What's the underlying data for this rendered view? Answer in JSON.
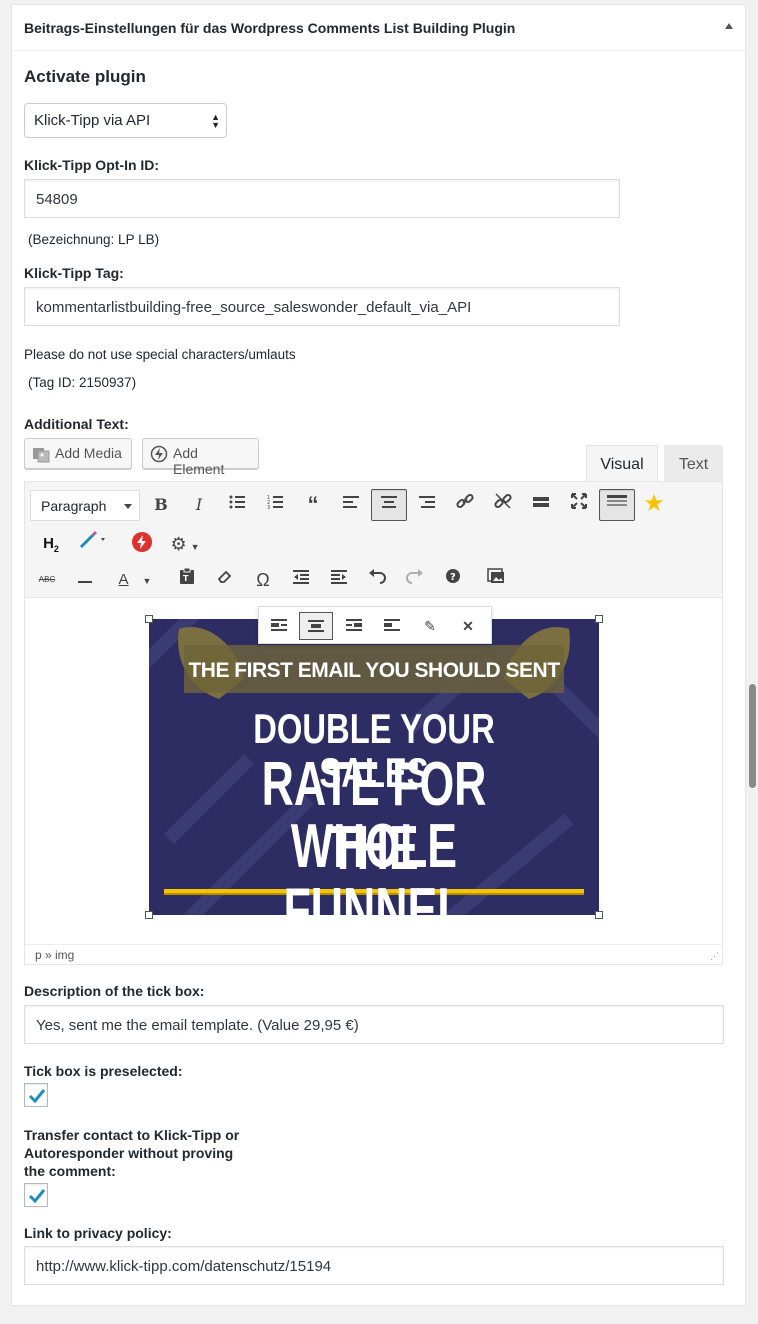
{
  "metabox": {
    "title": "Beitrags-Einstellungen für das Wordpress Comments List Building Plugin"
  },
  "activate": {
    "heading": "Activate plugin",
    "select_value": "Klick-Tipp via API"
  },
  "optin": {
    "label": "Klick-Tipp Opt-In ID:",
    "value": "54809",
    "note": "(Bezeichnung: LP LB)"
  },
  "tag": {
    "label": "Klick-Tipp Tag:",
    "value": "kommentarlistbuilding-free_source_saleswonder_default_via_API",
    "warning": "Please do not use special characters/umlauts",
    "tag_id": "(Tag ID: 2150937)"
  },
  "additional": {
    "label": "Additional Text:",
    "add_media": "Add Media",
    "add_element": "Add Element",
    "tab_visual": "Visual",
    "tab_text": "Text",
    "format_select": "Paragraph",
    "statusbar": "p » img",
    "image": {
      "line1": "THE FIRST EMAIL YOU SHOULD SENT",
      "line2": "DOUBLE YOUR SALES",
      "line3": "RATE FOR THE",
      "line4": "WHOLE FUNNEL"
    }
  },
  "tickbox_desc": {
    "label": "Description of the tick box:",
    "value": "Yes, sent me the email template. (Value 29,95 €)"
  },
  "preselected": {
    "label": "Tick box is preselected:",
    "checked": true
  },
  "transfer": {
    "label_line1": "Transfer contact to Klick-Tipp or",
    "label_line2": "Autoresponder without proving",
    "label_line3": "the comment:",
    "checked": true
  },
  "privacy": {
    "label": "Link to privacy policy:",
    "value": "http://www.klick-tipp.com/datenschutz/15194"
  },
  "colors": {
    "accent": "#1e8cbe",
    "image_bg": "#2d2d63",
    "gold": "#f5c400"
  }
}
